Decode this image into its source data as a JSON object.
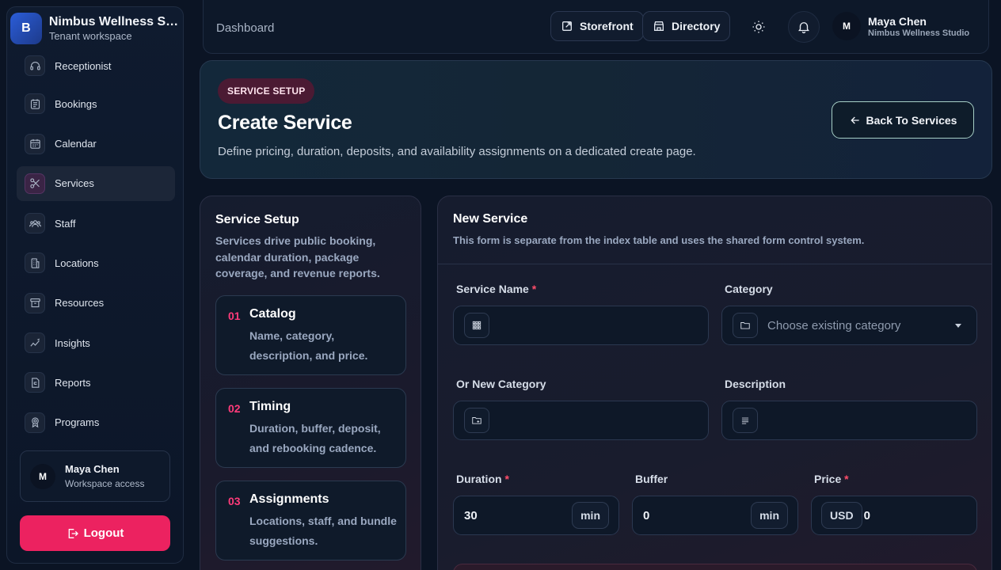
{
  "brand": {
    "logo_letter": "B",
    "name": "Nimbus Wellness Studio",
    "subtitle": "Tenant workspace"
  },
  "sidebar": {
    "items": [
      {
        "label": "Receptionist",
        "icon": "headset-icon"
      },
      {
        "label": "Bookings",
        "icon": "bookings-icon"
      },
      {
        "label": "Calendar",
        "icon": "calendar-icon"
      },
      {
        "label": "Services",
        "icon": "scissors-icon",
        "active": true
      },
      {
        "label": "Staff",
        "icon": "staff-icon"
      },
      {
        "label": "Locations",
        "icon": "building-icon"
      },
      {
        "label": "Resources",
        "icon": "archive-icon"
      },
      {
        "label": "Insights",
        "icon": "insights-icon"
      },
      {
        "label": "Reports",
        "icon": "report-icon"
      },
      {
        "label": "Programs",
        "icon": "award-icon"
      }
    ],
    "user": {
      "initial": "M",
      "name": "Maya Chen",
      "role": "Workspace access"
    },
    "logout_label": "Logout"
  },
  "topbar": {
    "breadcrumb": "Dashboard",
    "storefront_label": "Storefront",
    "directory_label": "Directory",
    "user": {
      "initial": "M",
      "name": "Maya Chen",
      "workspace": "Nimbus Wellness Studio"
    }
  },
  "hero": {
    "badge": "SERVICE SETUP",
    "title": "Create Service",
    "description": "Define pricing, duration, deposits, and availability assignments on a dedicated create page.",
    "back_label": "Back To Services"
  },
  "setup": {
    "title": "Service Setup",
    "description": "Services drive public booking, calendar duration, package coverage, and revenue reports.",
    "steps": [
      {
        "num": "01",
        "title": "Catalog",
        "desc": "Name, category, description, and price."
      },
      {
        "num": "02",
        "title": "Timing",
        "desc": "Duration, buffer, deposit, and rebooking cadence."
      },
      {
        "num": "03",
        "title": "Assignments",
        "desc": "Locations, staff, and bundle suggestions."
      }
    ]
  },
  "form": {
    "title": "New Service",
    "subtitle": "This form is separate from the index table and uses the shared form control system.",
    "service_name_label": "Service Name",
    "service_name_value": "",
    "category_label": "Category",
    "category_placeholder": "Choose existing category",
    "new_category_label": "Or New Category",
    "new_category_value": "",
    "description_label": "Description",
    "description_value": "",
    "duration_label": "Duration",
    "duration_value": "30",
    "duration_unit": "min",
    "buffer_label": "Buffer",
    "buffer_value": "0",
    "buffer_unit": "min",
    "price_label": "Price",
    "price_currency": "USD",
    "price_value": "0",
    "required_mark": "*"
  }
}
